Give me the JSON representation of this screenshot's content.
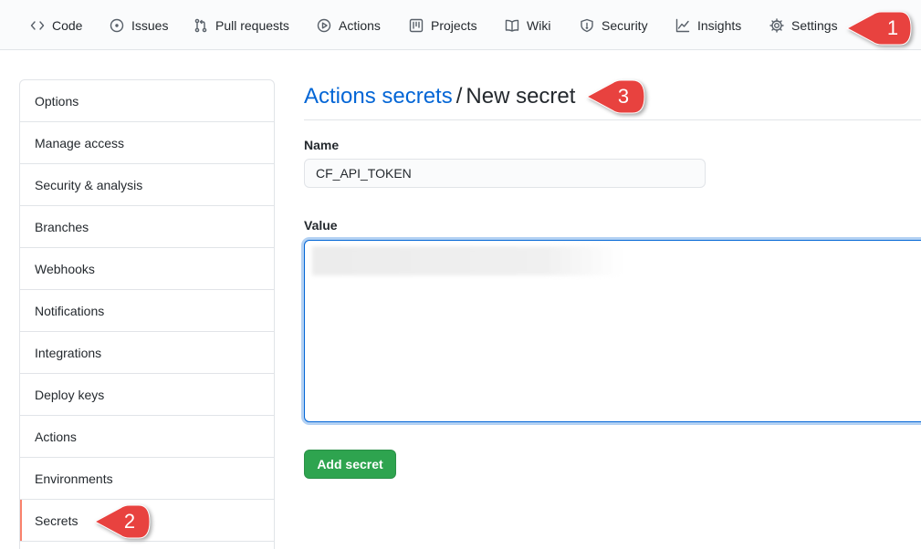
{
  "nav": {
    "items": [
      {
        "label": "Code",
        "icon": "code-icon"
      },
      {
        "label": "Issues",
        "icon": "issue-icon"
      },
      {
        "label": "Pull requests",
        "icon": "pull-request-icon"
      },
      {
        "label": "Actions",
        "icon": "play-icon"
      },
      {
        "label": "Projects",
        "icon": "project-icon"
      },
      {
        "label": "Wiki",
        "icon": "book-icon"
      },
      {
        "label": "Security",
        "icon": "shield-icon"
      },
      {
        "label": "Insights",
        "icon": "graph-icon"
      },
      {
        "label": "Settings",
        "icon": "gear-icon"
      }
    ],
    "active": "Settings"
  },
  "sidebar": {
    "items": [
      {
        "label": "Options"
      },
      {
        "label": "Manage access"
      },
      {
        "label": "Security & analysis"
      },
      {
        "label": "Branches"
      },
      {
        "label": "Webhooks"
      },
      {
        "label": "Notifications"
      },
      {
        "label": "Integrations"
      },
      {
        "label": "Deploy keys"
      },
      {
        "label": "Actions"
      },
      {
        "label": "Environments"
      },
      {
        "label": "Secrets"
      }
    ],
    "selected": "Secrets"
  },
  "main": {
    "breadcrumb_link": "Actions secrets",
    "breadcrumb_separator": "/",
    "breadcrumb_current": "New secret",
    "name_label": "Name",
    "name_value": "CF_API_TOKEN",
    "value_label": "Value",
    "add_button": "Add secret"
  },
  "annotations": [
    {
      "number": "1",
      "color": "#e8423f"
    },
    {
      "number": "2",
      "color": "#e8423f"
    },
    {
      "number": "3",
      "color": "#e8423f"
    }
  ],
  "colors": {
    "link": "#0366d6",
    "primary_button": "#2ea44f",
    "selected_indicator": "#f9826c",
    "callout": "#e8423f"
  }
}
